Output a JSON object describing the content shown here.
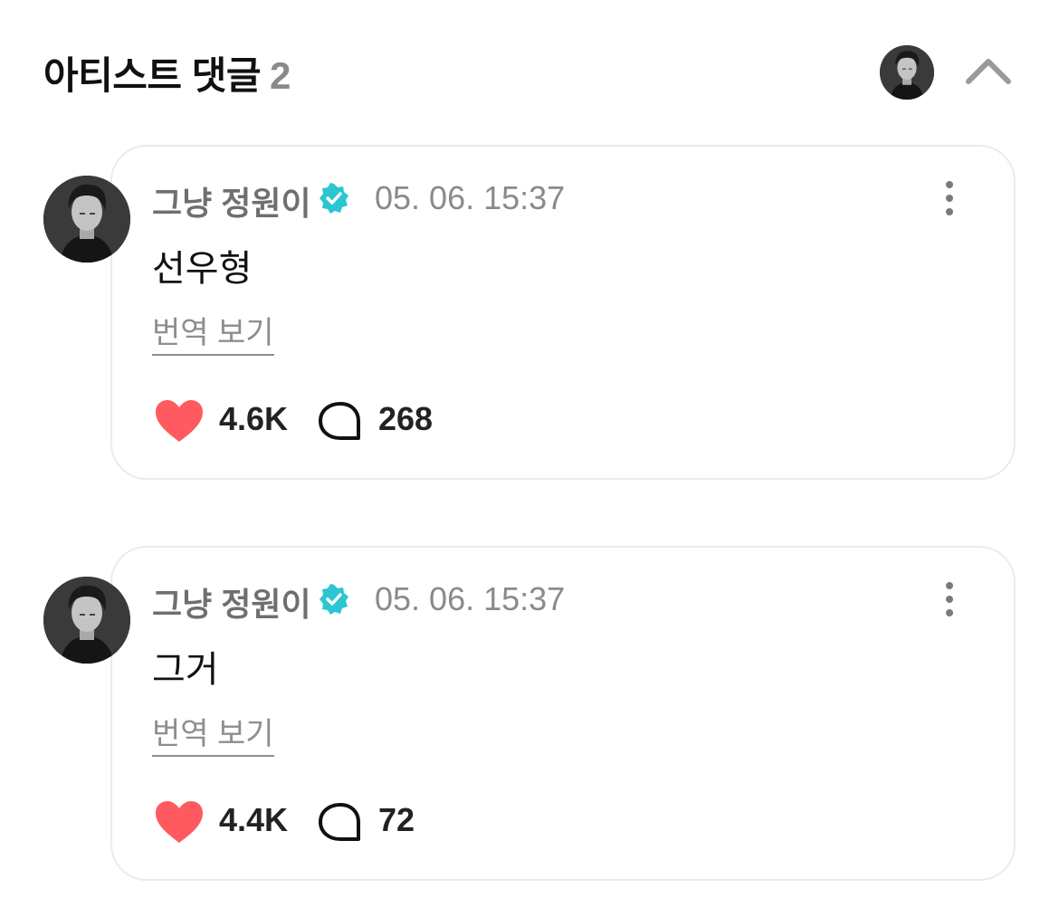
{
  "header": {
    "title": "아티스트 댓글",
    "count": "2"
  },
  "comments": [
    {
      "author": "그냥 정원이",
      "timestamp": "05. 06. 15:37",
      "text": "선우형",
      "translate_label": "번역 보기",
      "likes": "4.6K",
      "replies": "268"
    },
    {
      "author": "그냥 정원이",
      "timestamp": "05. 06. 15:37",
      "text": "그거",
      "translate_label": "번역 보기",
      "likes": "4.4K",
      "replies": "72"
    }
  ],
  "colors": {
    "heart": "#ff5a5f",
    "verified": "#2cc5d2",
    "text_primary": "#111111",
    "text_secondary": "#8a8a8a",
    "card_border": "#ebebef"
  },
  "icons": {
    "verified": "verified-badge-icon",
    "like": "heart-icon",
    "reply": "speech-bubble-icon",
    "more": "more-vertical-icon",
    "collapse": "chevron-up-icon"
  }
}
